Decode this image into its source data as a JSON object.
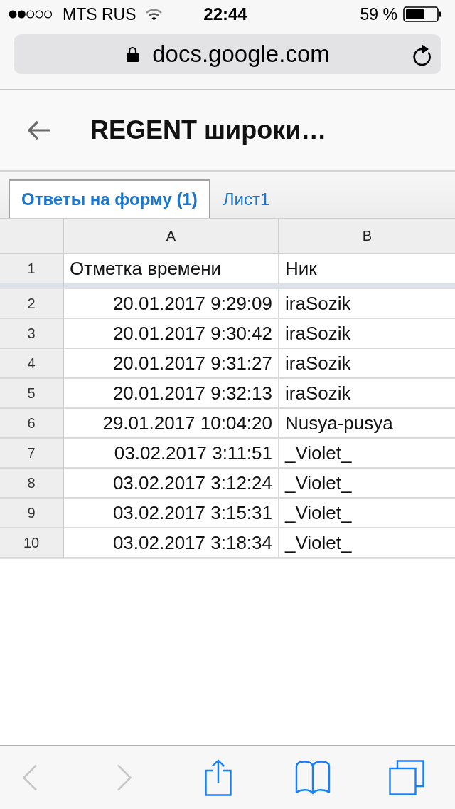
{
  "status_bar": {
    "carrier": "MTS RUS",
    "time": "22:44",
    "battery": "59 %"
  },
  "address_bar": {
    "url": "docs.google.com"
  },
  "header": {
    "title": "REGENT широки…"
  },
  "sheet_tabs": [
    {
      "label": "Ответы на форму (1)",
      "selected": true
    },
    {
      "label": "Лист1",
      "selected": false
    }
  ],
  "table": {
    "columns": [
      "A",
      "B"
    ],
    "frozen_rows": [
      {
        "number": "1",
        "cells": [
          "Отметка времени",
          "Ник"
        ]
      }
    ],
    "rows": [
      {
        "number": "2",
        "cells": [
          "20.01.2017 9:29:09",
          "iraSozik"
        ]
      },
      {
        "number": "3",
        "cells": [
          "20.01.2017 9:30:42",
          "iraSozik"
        ]
      },
      {
        "number": "4",
        "cells": [
          "20.01.2017 9:31:27",
          "iraSozik"
        ]
      },
      {
        "number": "5",
        "cells": [
          "20.01.2017 9:32:13",
          "iraSozik"
        ]
      },
      {
        "number": "6",
        "cells": [
          "29.01.2017 10:04:20",
          "Nusya-pusya"
        ]
      },
      {
        "number": "7",
        "cells": [
          "03.02.2017 3:11:51",
          "_Violet_"
        ]
      },
      {
        "number": "8",
        "cells": [
          "03.02.2017 3:12:24",
          "_Violet_"
        ]
      },
      {
        "number": "9",
        "cells": [
          "03.02.2017 3:15:31",
          "_Violet_"
        ]
      },
      {
        "number": "10",
        "cells": [
          "03.02.2017 3:18:34",
          "_Violet_"
        ]
      }
    ]
  },
  "toolbar": [
    {
      "kind": "back",
      "disabled": true
    },
    {
      "kind": "forward",
      "disabled": true
    },
    {
      "kind": "share",
      "disabled": false
    },
    {
      "kind": "bookmarks",
      "disabled": false
    },
    {
      "kind": "tabs",
      "disabled": false
    }
  ]
}
